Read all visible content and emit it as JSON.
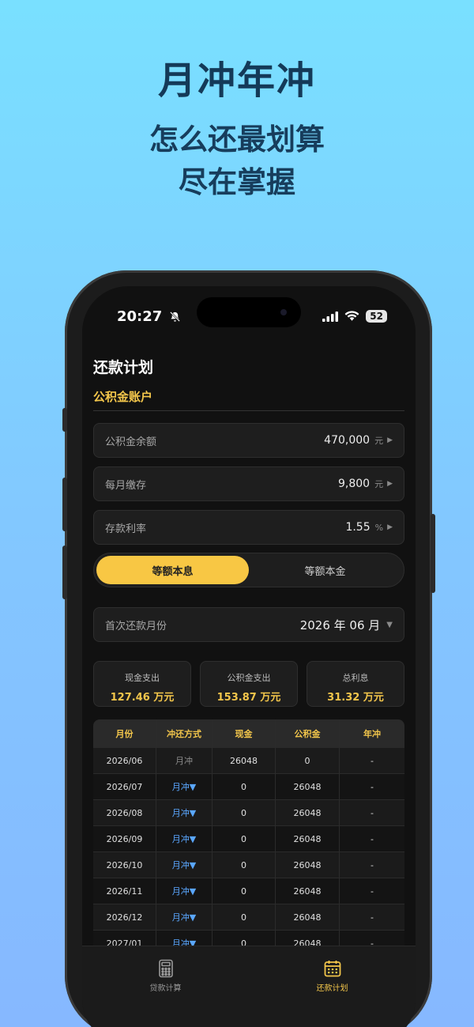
{
  "promo": {
    "headline": "月冲年冲",
    "line1": "怎么还最划算",
    "line2": "尽在掌握"
  },
  "status_bar": {
    "time": "20:27",
    "battery": "52"
  },
  "page": {
    "title": "还款计划",
    "section": "公积金账户"
  },
  "fields": [
    {
      "label": "公积金余额",
      "value": "470,000",
      "unit": "元"
    },
    {
      "label": "每月缴存",
      "value": "9,800",
      "unit": "元"
    },
    {
      "label": "存款利率",
      "value": "1.55",
      "unit": "%"
    }
  ],
  "segment": {
    "options": [
      "等额本息",
      "等额本金"
    ],
    "selected": 0
  },
  "first_month": {
    "label": "首次还款月份",
    "value": "2026 年 06 月"
  },
  "summary": [
    {
      "label": "现金支出",
      "value": "127.46 万元"
    },
    {
      "label": "公积金支出",
      "value": "153.87 万元"
    },
    {
      "label": "总利息",
      "value": "31.32 万元"
    }
  ],
  "table": {
    "headers": [
      "月份",
      "冲还方式",
      "现金",
      "公积金",
      "年冲"
    ],
    "rows": [
      {
        "month": "2026/06",
        "mode": "月冲",
        "mode_dropdown": false,
        "cash": "26048",
        "fund": "0",
        "year": "-"
      },
      {
        "month": "2026/07",
        "mode": "月冲▼",
        "mode_dropdown": true,
        "cash": "0",
        "fund": "26048",
        "year": "-"
      },
      {
        "month": "2026/08",
        "mode": "月冲▼",
        "mode_dropdown": true,
        "cash": "0",
        "fund": "26048",
        "year": "-"
      },
      {
        "month": "2026/09",
        "mode": "月冲▼",
        "mode_dropdown": true,
        "cash": "0",
        "fund": "26048",
        "year": "-"
      },
      {
        "month": "2026/10",
        "mode": "月冲▼",
        "mode_dropdown": true,
        "cash": "0",
        "fund": "26048",
        "year": "-"
      },
      {
        "month": "2026/11",
        "mode": "月冲▼",
        "mode_dropdown": true,
        "cash": "0",
        "fund": "26048",
        "year": "-"
      },
      {
        "month": "2026/12",
        "mode": "月冲▼",
        "mode_dropdown": true,
        "cash": "0",
        "fund": "26048",
        "year": "-"
      },
      {
        "month": "2027/01",
        "mode": "月冲▼",
        "mode_dropdown": true,
        "cash": "0",
        "fund": "26048",
        "year": "-"
      }
    ]
  },
  "tabbar": [
    {
      "label": "贷款计算",
      "icon": "calculator-icon"
    },
    {
      "label": "还款计划",
      "icon": "calendar-icon",
      "active": true
    }
  ],
  "colors": {
    "accent": "#f8c744",
    "link": "#5aa7ff",
    "background": "#111111"
  }
}
